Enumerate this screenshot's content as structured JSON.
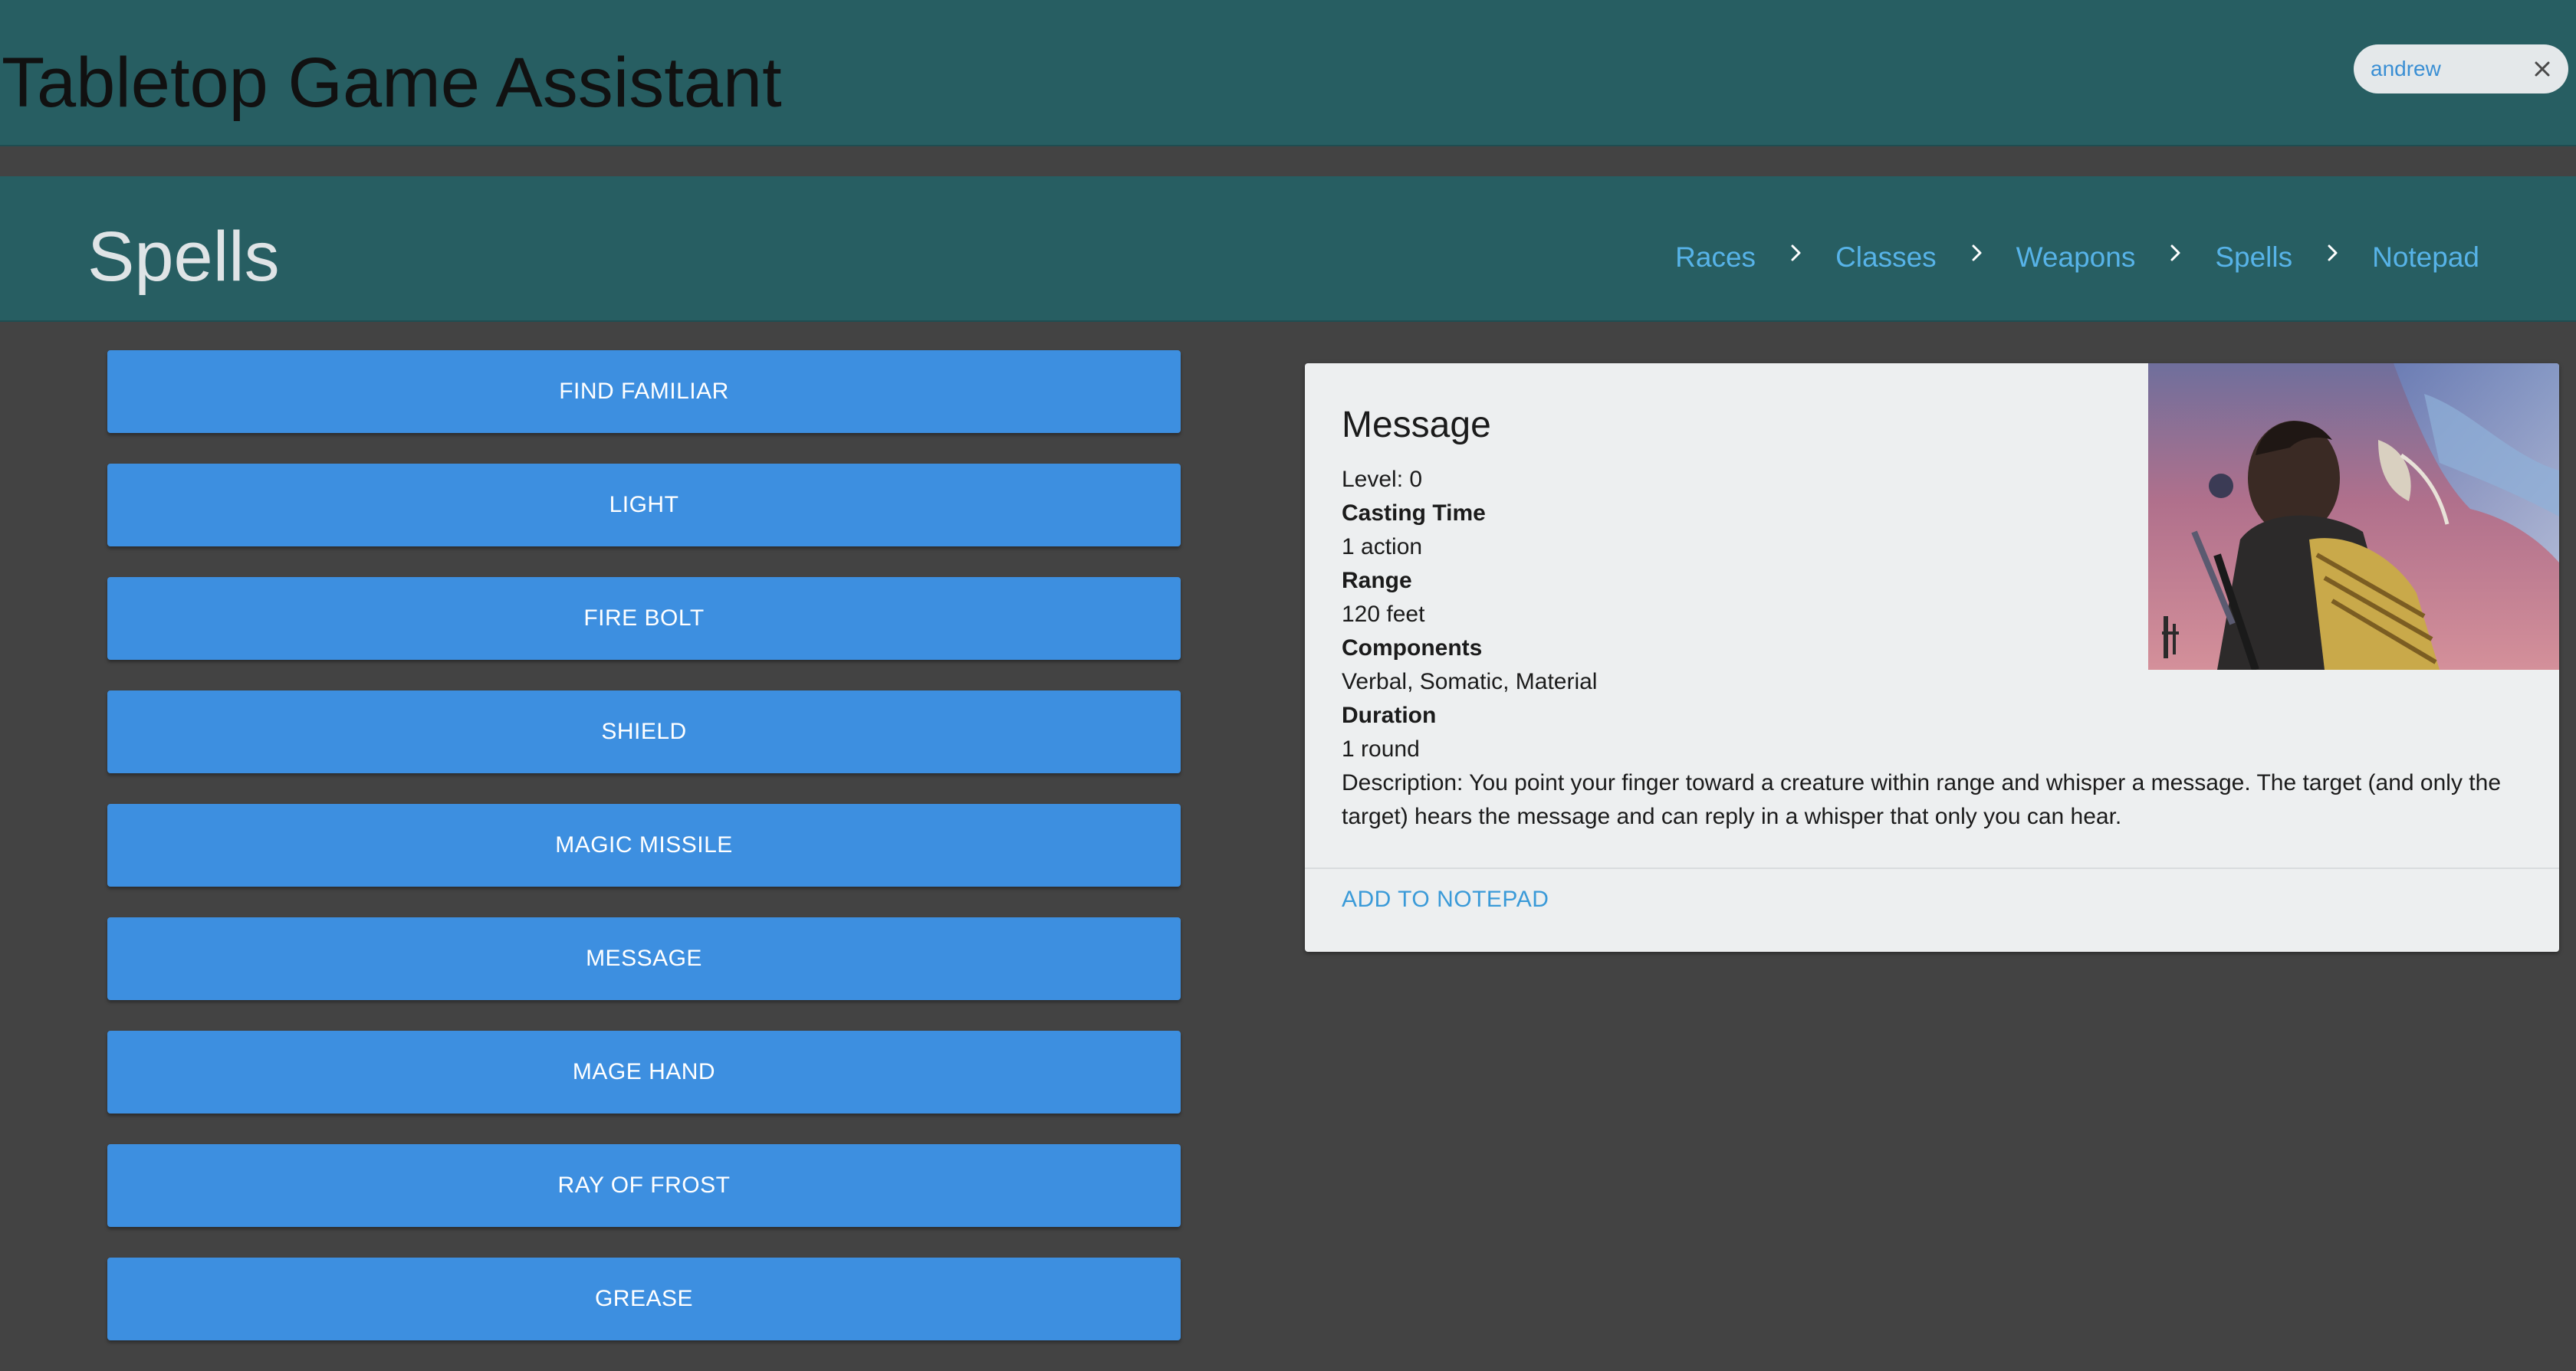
{
  "app": {
    "title": "Tabletop Game Assistant",
    "user_chip": {
      "label": "andrew",
      "close_icon": "close-icon"
    }
  },
  "page": {
    "title": "Spells",
    "breadcrumb": [
      {
        "label": "Races"
      },
      {
        "label": "Classes"
      },
      {
        "label": "Weapons"
      },
      {
        "label": "Spells"
      },
      {
        "label": "Notepad"
      }
    ],
    "separator_icon": "chevron-right-icon"
  },
  "spells": [
    "FIND FAMILIAR",
    "LIGHT",
    "FIRE BOLT",
    "SHIELD",
    "MAGIC MISSILE",
    "MESSAGE",
    "MAGE HAND",
    "RAY OF FROST",
    "GREASE"
  ],
  "selected_spell": {
    "name": "Message",
    "level_line": "Level: 0",
    "casting_time_label": "Casting Time",
    "casting_time": "1 action",
    "range_label": "Range",
    "range": "120 feet",
    "components_label": "Components",
    "components": "Verbal, Somatic, Material",
    "duration_label": "Duration",
    "duration": "1 round",
    "description": "Description: You point your finger toward a creature within range and whisper a message. The target (and only the target) hears the message and can reply in a whisper that only you can hear.",
    "action_label": "ADD TO NOTEPAD",
    "image": "fantasy-warrior-illustration"
  },
  "colors": {
    "header_bg": "#275e62",
    "page_bg": "#434343",
    "button_bg": "#3d8fe0",
    "link": "#57b3e8",
    "card_bg": "#edeff0"
  }
}
